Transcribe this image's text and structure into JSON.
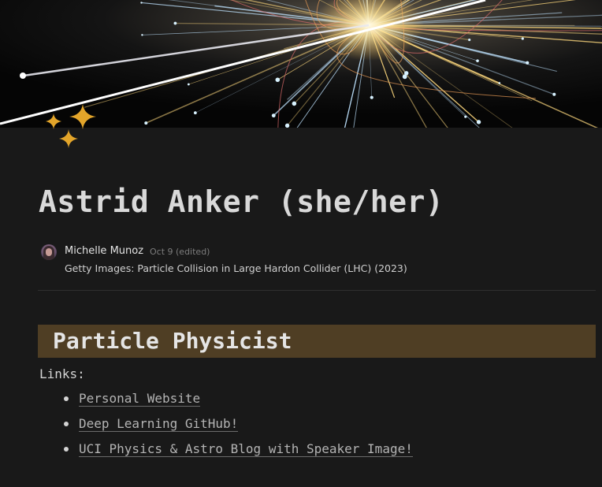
{
  "page": {
    "title": "Astrid Anker (she/her)"
  },
  "cover": {
    "description_icon": "particle-collision-image",
    "accent_color": "#f3c86a"
  },
  "icon": {
    "name": "sparkles-icon",
    "color": "#e3a52a"
  },
  "comment": {
    "author": "Michelle Munoz",
    "time": "Oct 9 (edited)",
    "text": "Getty Images: Particle Collision in Large Hardon Collider (LHC) (2023)"
  },
  "section": {
    "heading": "Particle Physicist",
    "heading_bg": "#4f3e24"
  },
  "links": {
    "label": "Links:",
    "items": [
      {
        "label": "Personal Website"
      },
      {
        "label": "Deep Learning GitHub!"
      },
      {
        "label": "UCI Physics & Astro Blog with Speaker Image!"
      }
    ]
  }
}
